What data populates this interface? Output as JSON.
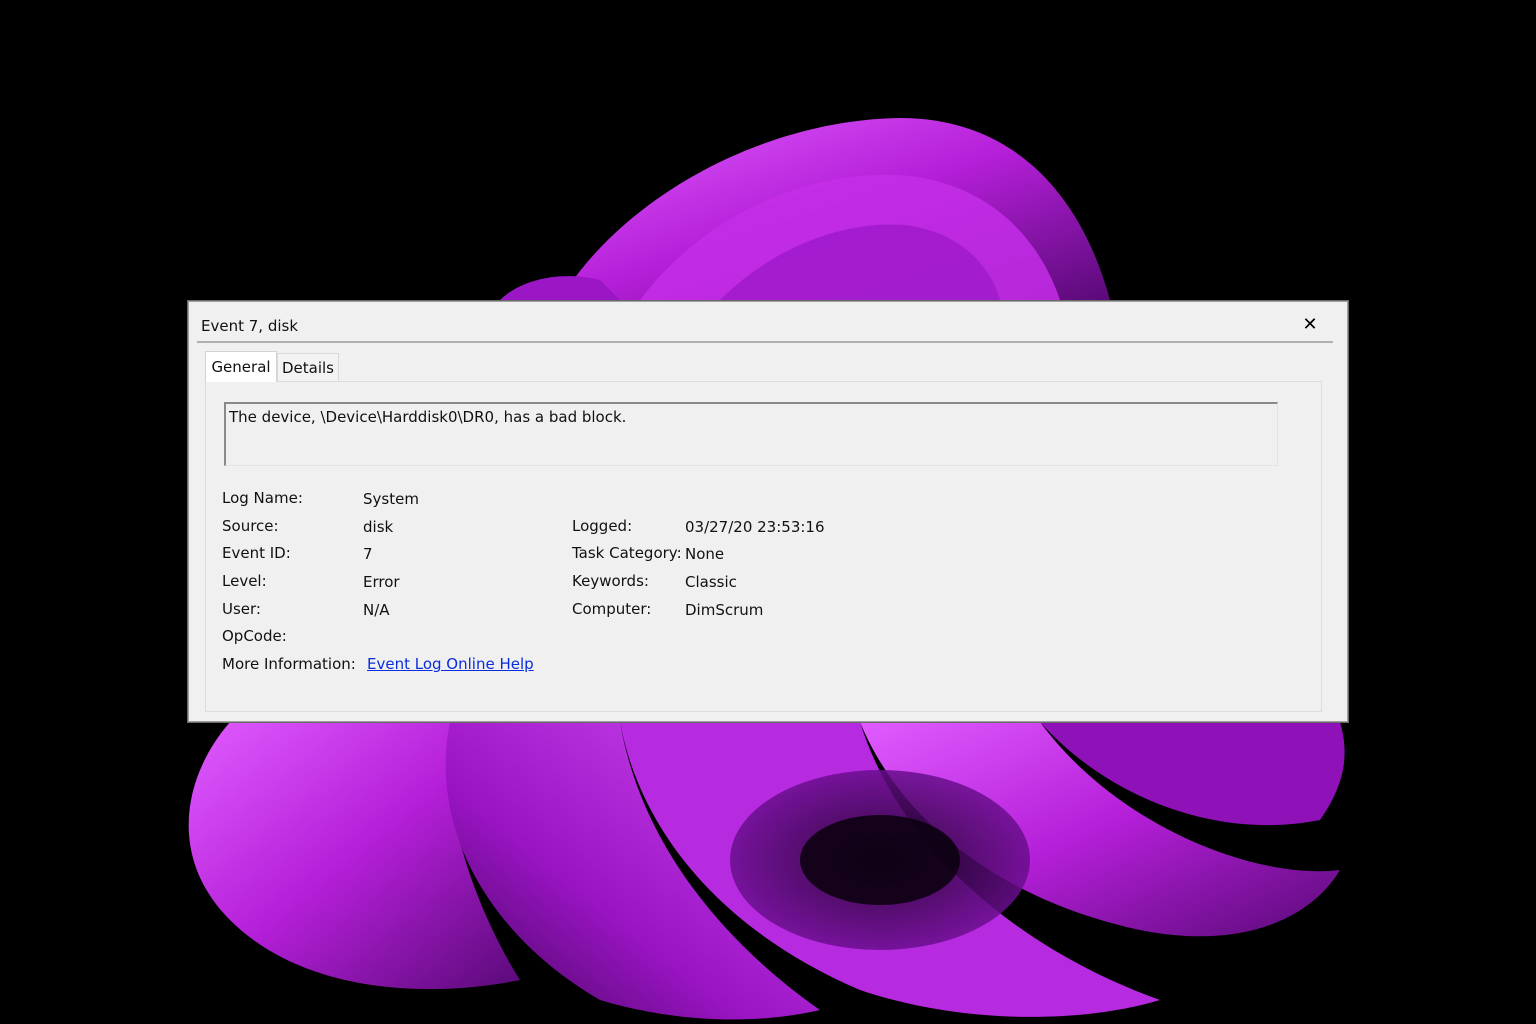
{
  "dialog": {
    "title": "Event 7, disk",
    "close_glyph": "✕"
  },
  "tabs": [
    {
      "label": "General",
      "active": true
    },
    {
      "label": "Details",
      "active": false
    }
  ],
  "message": "The device, \\Device\\Harddisk0\\DR0, has a bad block.",
  "fields": {
    "log_name": {
      "label": "Log Name:",
      "value": "System"
    },
    "source": {
      "label": "Source:",
      "value": "disk"
    },
    "event_id": {
      "label": "Event ID:",
      "value": "7"
    },
    "level": {
      "label": "Level:",
      "value": "Error"
    },
    "user": {
      "label": "User:",
      "value": "N/A"
    },
    "opcode": {
      "label": "OpCode:",
      "value": ""
    },
    "more_info": {
      "label": "More Information:",
      "link": "Event Log Online Help"
    },
    "logged": {
      "label": "Logged:",
      "value": "03/27/20 23:53:16"
    },
    "task_category": {
      "label": "Task Category:",
      "value": "None"
    },
    "keywords": {
      "label": "Keywords:",
      "value": "Classic"
    },
    "computer": {
      "label": "Computer:",
      "value": "DimScrum"
    }
  },
  "colors": {
    "wallpaper_background": "#000000",
    "wallpaper_accent": "#b41fd8",
    "link": "#0a2ce0"
  }
}
